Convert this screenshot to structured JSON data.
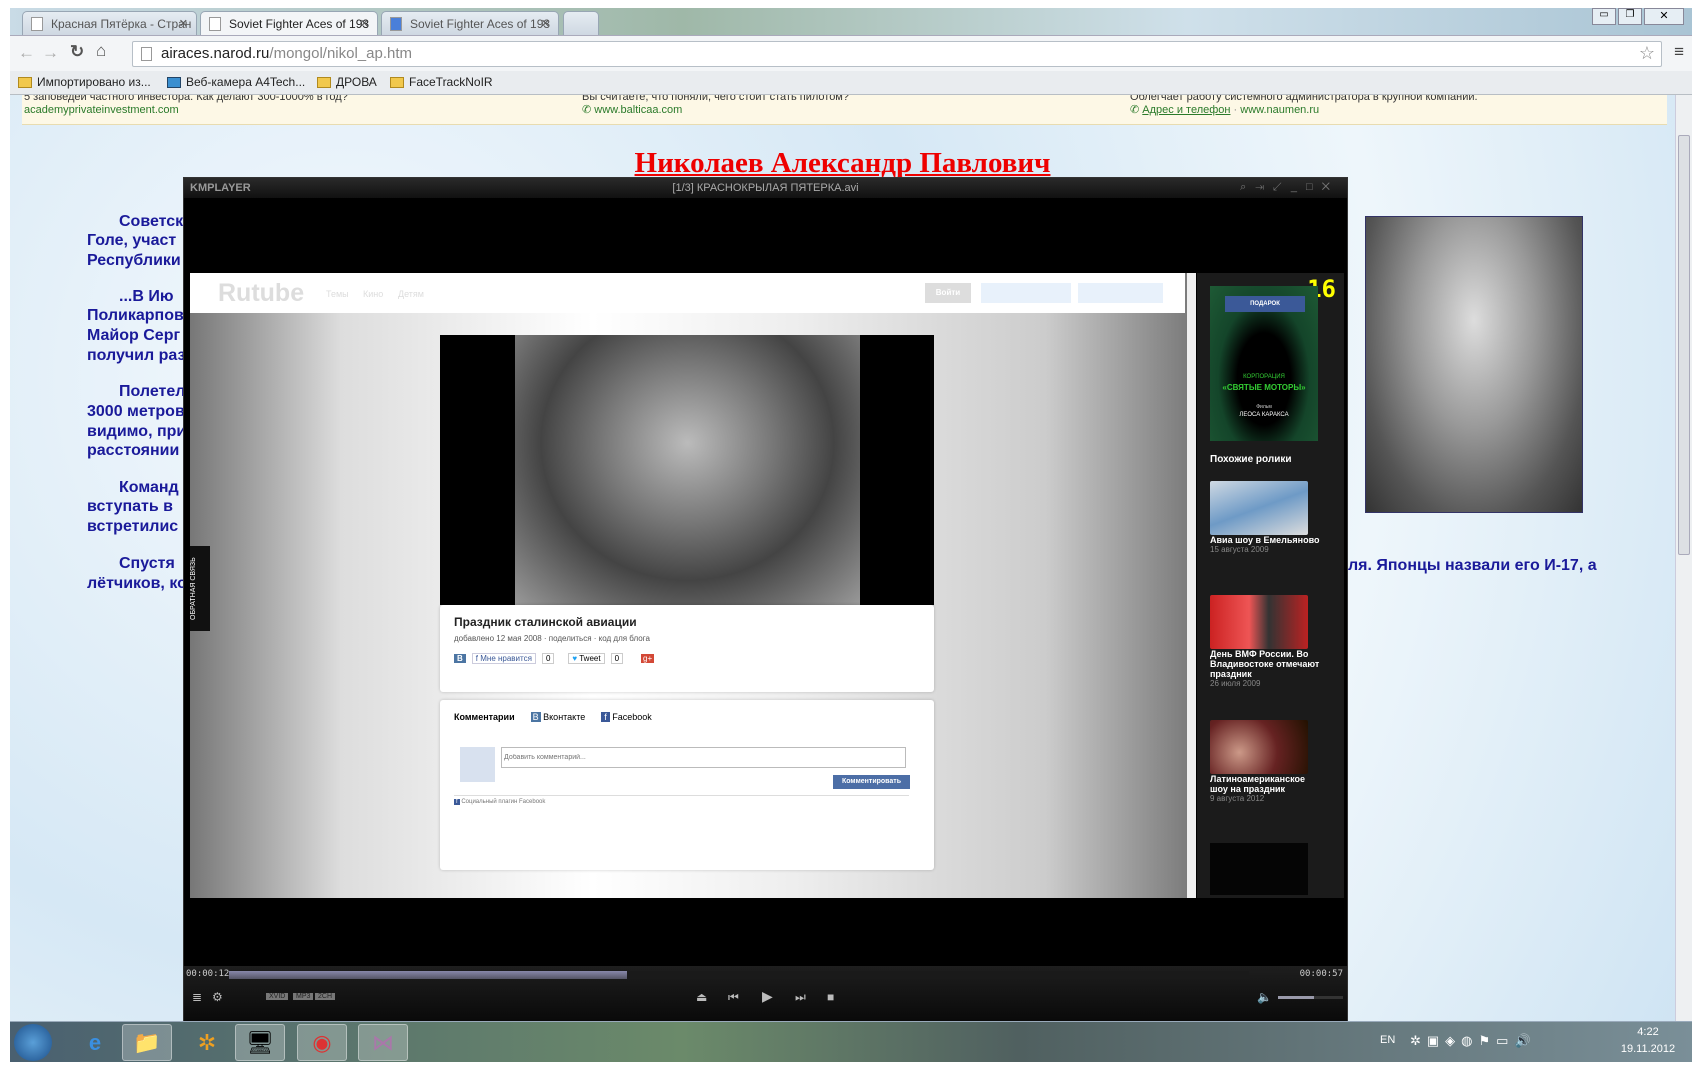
{
  "browser": {
    "tabs": [
      {
        "label": "Красная Пятёрка - Стран"
      },
      {
        "label": "Soviet Fighter Aces of 193",
        "active": true
      },
      {
        "label": "Soviet Fighter Aces of 193"
      }
    ],
    "url_host": "airaces.narod.ru",
    "url_path": "/mongol/nikol_ap.htm",
    "bookmarks": [
      "Импортировано из...",
      "Веб-камера A4Tech...",
      "ДРОВА",
      "FaceTrackNoIR"
    ]
  },
  "ads": [
    {
      "text": "5 заповедей частного инвестора. Как делают 300-1000% в год?",
      "url": "academyprivateinvestment.com"
    },
    {
      "text": "Вы считаете, что поняли, чего стоит стать пилотом?",
      "url": "www.balticaa.com"
    },
    {
      "text": "Облегчает работу системного администратора в крупной компании.",
      "link": "Адрес и телефон",
      "url": "www.naumen.ru"
    }
  ],
  "page": {
    "heading": "Николаев Александр Павлович",
    "lines": [
      "Советск",
      "Голе, участ",
      "Республики",
      "...В  Ию",
      "Поликарпов",
      "Майор Серг",
      "получил раз",
      "Полетел",
      "3000 метров",
      "видимо, при",
      "расстоянии",
      "Команд",
      "вступать в",
      "встретилис",
      "Спустя",
      "лётчиков, ко"
    ],
    "right_line": "ля. Японцы назвали его И-17, а"
  },
  "player": {
    "logo": "KMPLAYER",
    "title": "[1/3] КРАСНОКРЫЛАЯ ПЯТЕРКА.avi",
    "time_current": "00:00:12",
    "time_total": "00:00:57",
    "progress": 0.39,
    "volume": 0.55,
    "badges": [
      "XVID",
      "MP3",
      "2CH"
    ]
  },
  "rutube": {
    "logo": "Rutube",
    "nav": [
      "Темы",
      "Кино",
      "Детям"
    ],
    "login": "Войти",
    "feedback": "ОБРАТНАЯ СВЯЗЬ",
    "video_title": "Праздник сталинской авиации",
    "meta": [
      "добавлено 12 мая 2008",
      "поделиться",
      "код для блога"
    ],
    "vk": "В",
    "like": "Мне нравится",
    "like_count": "0",
    "tweet": "Tweet",
    "tweet_count": "0",
    "comments": {
      "title": "Комментарии",
      "tabs": [
        "Вконтакте",
        "Facebook"
      ],
      "placeholder": "Добавить комментарий...",
      "submit": "Комментировать",
      "plugin": "Социальный плагин Facebook"
    },
    "age": "16",
    "promo": {
      "badge": "ПОДАРОК",
      "line1": "КОРПОРАЦИЯ",
      "line2": "«СВЯТЫЕ МОТОРЫ»",
      "line3": "Фильм",
      "line4": "ЛЕОСА КАРАКСА"
    },
    "related_title": "Похожие ролики",
    "related": [
      {
        "title": "Авиа шоу в Емельяново",
        "date": "15 августа 2009"
      },
      {
        "title": "День ВМФ России. Во Владивостоке отмечают праздник",
        "date": "26 июля 2009"
      },
      {
        "title": "Латиноамериканское шоу на праздник",
        "date": "9 августа 2012"
      }
    ]
  },
  "taskbar": {
    "lang": "EN",
    "time": "4:22",
    "date": "19.11.2012"
  }
}
